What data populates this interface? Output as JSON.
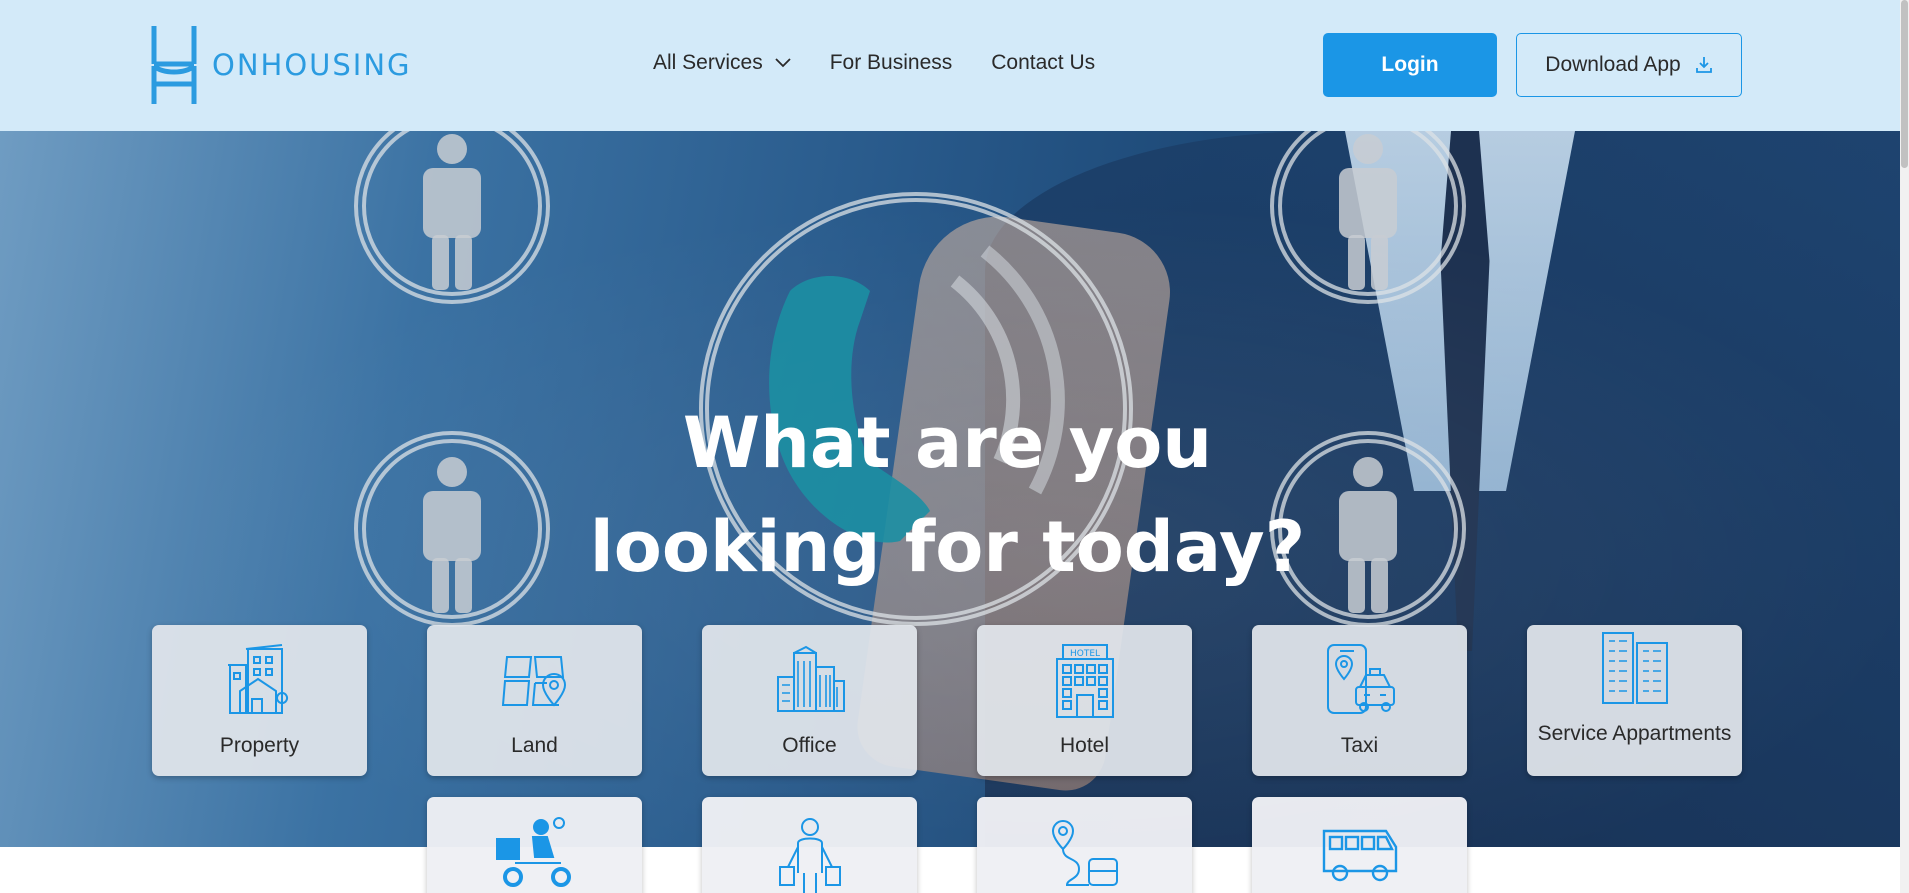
{
  "brand": {
    "name": "ONHOUSING",
    "color": "#2b9be0"
  },
  "nav": {
    "items": [
      {
        "label": "All Services",
        "has_dropdown": true
      },
      {
        "label": "For Business"
      },
      {
        "label": "Contact Us"
      }
    ]
  },
  "header_actions": {
    "login_label": "Login",
    "download_label": "Download App",
    "accent": "#1b96e6"
  },
  "hero": {
    "title_line1": "What are you",
    "title_line2": "looking for today?"
  },
  "services": {
    "row1": [
      {
        "label": "Property",
        "icon": "property-icon"
      },
      {
        "label": "Land",
        "icon": "land-map-icon"
      },
      {
        "label": "Office",
        "icon": "office-building-icon"
      },
      {
        "label": "Hotel",
        "icon": "hotel-icon"
      },
      {
        "label": "Taxi",
        "icon": "taxi-icon"
      },
      {
        "label": "Service Appartments",
        "icon": "apartment-building-icon"
      }
    ],
    "row2": [
      {
        "icon": "delivery-scooter-icon"
      },
      {
        "icon": "shopper-icon"
      },
      {
        "icon": "route-bus-icon"
      },
      {
        "icon": "bus-icon"
      }
    ]
  }
}
